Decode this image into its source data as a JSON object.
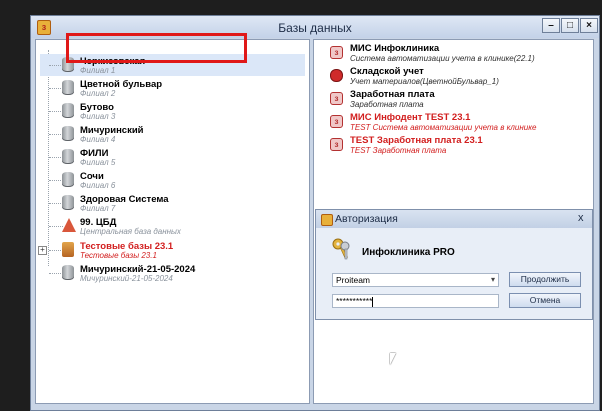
{
  "window": {
    "title": "Базы данных",
    "controls": {
      "minimize": "–",
      "maximize": "□",
      "close": "×"
    }
  },
  "databases": [
    {
      "name": "Черкизовская",
      "subtitle": "Филиал 1",
      "icon": "database-icon",
      "selected": true
    },
    {
      "name": "Цветной бульвар",
      "subtitle": "Филиал 2",
      "icon": "database-icon"
    },
    {
      "name": "Бутово",
      "subtitle": "Филиал 3",
      "icon": "database-icon"
    },
    {
      "name": "Мичуринский",
      "subtitle": "Филиал 4",
      "icon": "database-icon"
    },
    {
      "name": "ФИЛИ",
      "subtitle": "Филиал 5",
      "icon": "database-icon"
    },
    {
      "name": "Сочи",
      "subtitle": "Филиал 6",
      "icon": "database-icon"
    },
    {
      "name": "Здоровая Система",
      "subtitle": "Филиал 7",
      "icon": "database-icon"
    },
    {
      "name": "99. ЦБД",
      "subtitle": "Центральная база данных",
      "icon": "server-icon"
    },
    {
      "name": "Тестовые базы 23.1",
      "subtitle": "Тестовые базы 23.1",
      "icon": "books-icon",
      "expander": "+",
      "color": "#d21e1e"
    },
    {
      "name": "Мичуринский-21-05-2024",
      "subtitle": "Мичуринский-21-05-2024",
      "icon": "database-icon"
    }
  ],
  "modules": [
    {
      "name": "МИС Инфоклиника",
      "subtitle": "Система автоматизации учета в клинике(22.1)",
      "icon": "app-icon"
    },
    {
      "name": "Складской учет",
      "subtitle": "Учет материалов(ЦветнойБульвар_1)",
      "icon": "stock-icon"
    },
    {
      "name": "Заработная плата",
      "subtitle": "Заработная плата",
      "icon": "app-icon"
    },
    {
      "name": "МИС Инфодент TEST 23.1",
      "subtitle": "TEST Система автоматизации учета в клинике",
      "icon": "app-icon",
      "color": "#d21e1e"
    },
    {
      "name": "TEST Заработная плата 23.1",
      "subtitle": "TEST Заработная плата",
      "icon": "app-icon",
      "color": "#d21e1e"
    }
  ],
  "auth_dialog": {
    "title": "Авторизация",
    "close": "x",
    "product": "Инфоклиника PRO",
    "username": "Proiteam",
    "password_mask": "***********",
    "continue_label": "Продолжить",
    "cancel_label": "Отмена"
  },
  "colors": {
    "highlight": "#e01818",
    "test_red": "#d21e1e",
    "selection": "#dbe7f8"
  }
}
